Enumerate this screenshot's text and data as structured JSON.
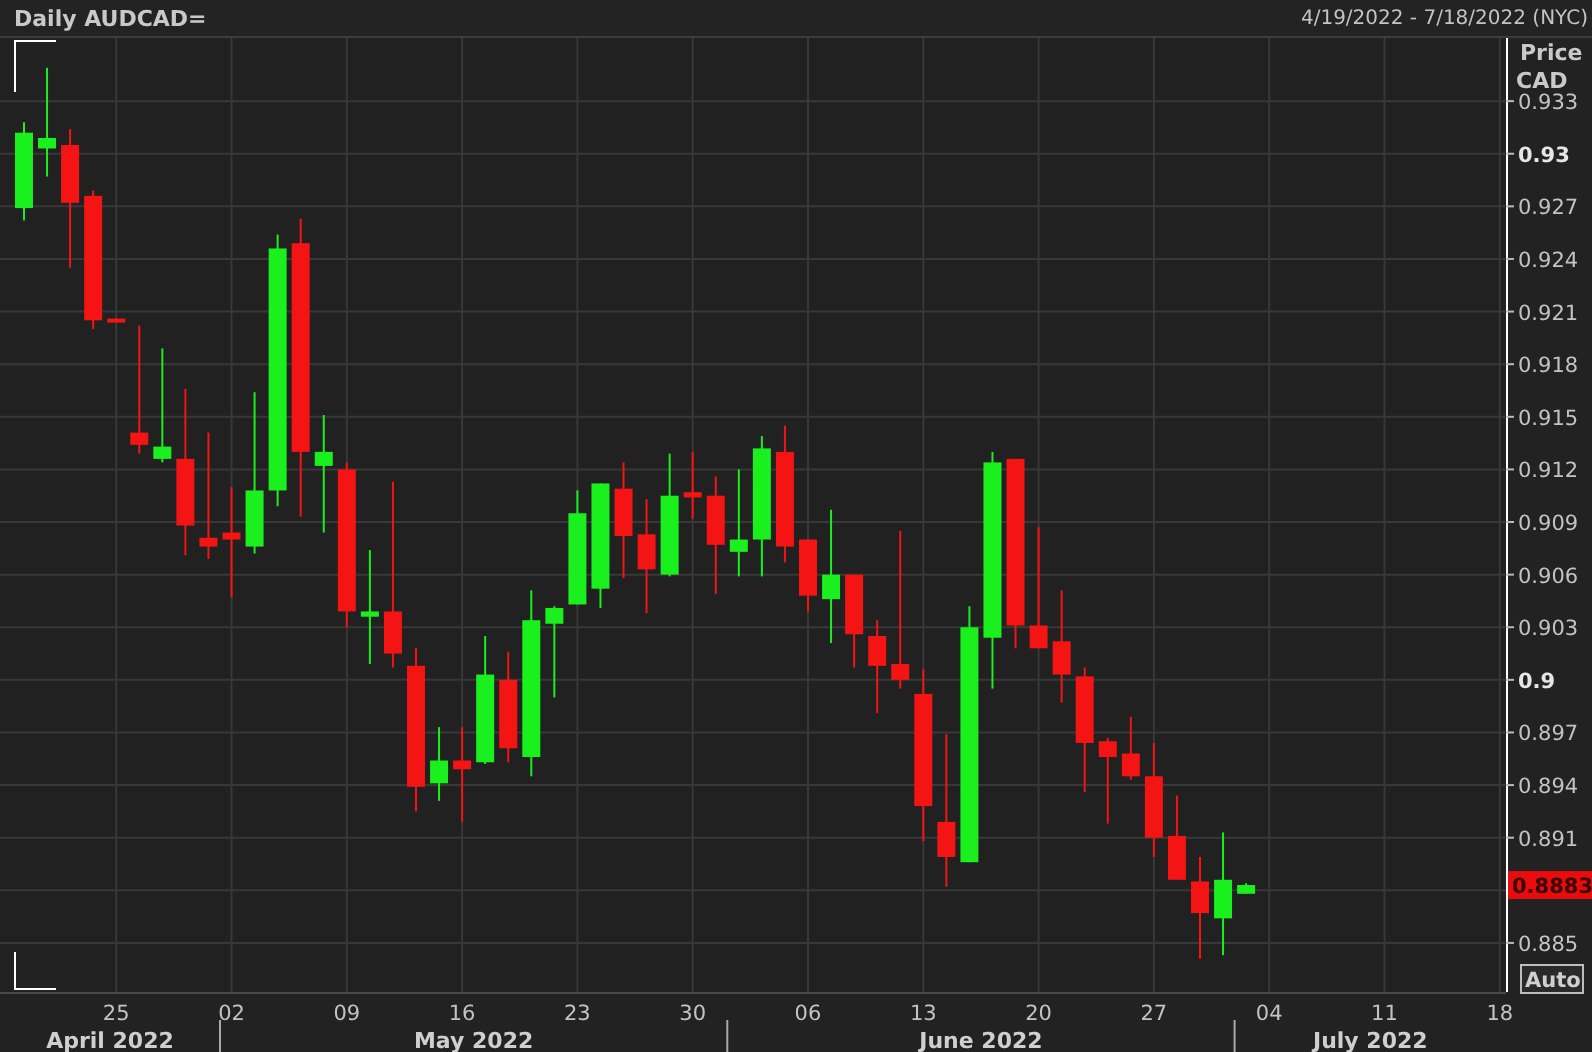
{
  "header": {
    "title": "Daily AUDCAD=",
    "range": "4/19/2022 - 7/18/2022 (NYC)"
  },
  "chart": {
    "y_axis_title": "Price",
    "y_axis_unit": "CAD",
    "price_labels": [
      {
        "label": "0.933",
        "major": false
      },
      {
        "label": "0.93",
        "major": true
      },
      {
        "label": "0.927",
        "major": false
      },
      {
        "label": "0.924",
        "major": false
      },
      {
        "label": "0.921",
        "major": false
      },
      {
        "label": "0.918",
        "major": false
      },
      {
        "label": "0.915",
        "major": false
      },
      {
        "label": "0.912",
        "major": false
      },
      {
        "label": "0.909",
        "major": false
      },
      {
        "label": "0.906",
        "major": false
      },
      {
        "label": "0.903",
        "major": false
      },
      {
        "label": "0.9",
        "major": true
      },
      {
        "label": "0.897",
        "major": false
      },
      {
        "label": "0.894",
        "major": false
      },
      {
        "label": "0.891",
        "major": false
      },
      {
        "label": "0.885",
        "major": false
      }
    ],
    "last_price_tag": "0.8883",
    "auto_button": "Auto",
    "date_labels": [
      "25",
      "02",
      "09",
      "16",
      "23",
      "30",
      "06",
      "13",
      "20",
      "27",
      "04",
      "11",
      "18"
    ],
    "month_labels": [
      "April 2022",
      "May 2022",
      "June 2022",
      "July 2022"
    ]
  }
}
